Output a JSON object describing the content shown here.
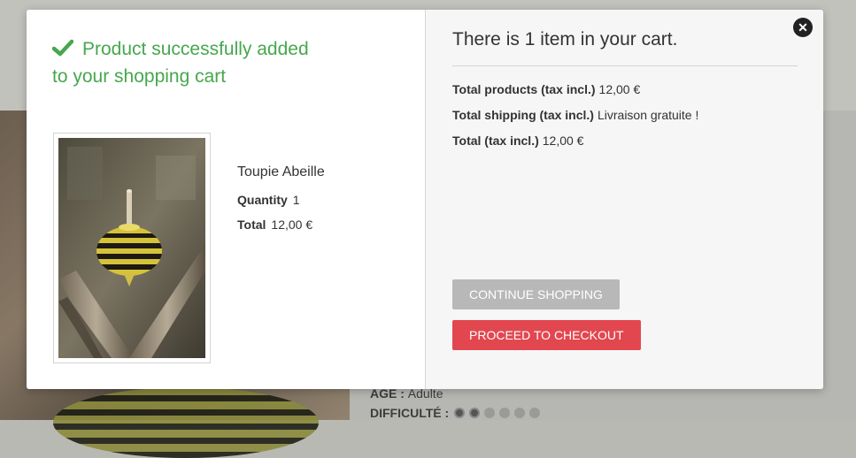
{
  "background": {
    "age_label": "AGE :",
    "age_value": "Adulte",
    "difficulty_label": "DIFFICULTÉ :",
    "difficulty_level": 2,
    "difficulty_max": 6
  },
  "modal": {
    "success_message": "Product successfully added to your shopping cart",
    "product": {
      "name": "Toupie Abeille",
      "quantity_label": "Quantity",
      "quantity": "1",
      "total_label": "Total",
      "total": "12,00 €"
    },
    "cart": {
      "title": "There is 1 item in your cart.",
      "total_products_label": "Total products (tax incl.)",
      "total_products": "12,00 €",
      "total_shipping_label": "Total shipping (tax incl.)",
      "total_shipping": "Livraison gratuite !",
      "total_label": "Total (tax incl.)",
      "total": "12,00 €"
    },
    "buttons": {
      "continue": "CONTINUE SHOPPING",
      "checkout": "PROCEED TO CHECKOUT"
    },
    "icons": {
      "success": "check-icon",
      "close": "close-icon"
    }
  },
  "colors": {
    "success_green": "#46a74e",
    "checkout_red": "#e2474f",
    "continue_gray": "#b8b8b8"
  }
}
